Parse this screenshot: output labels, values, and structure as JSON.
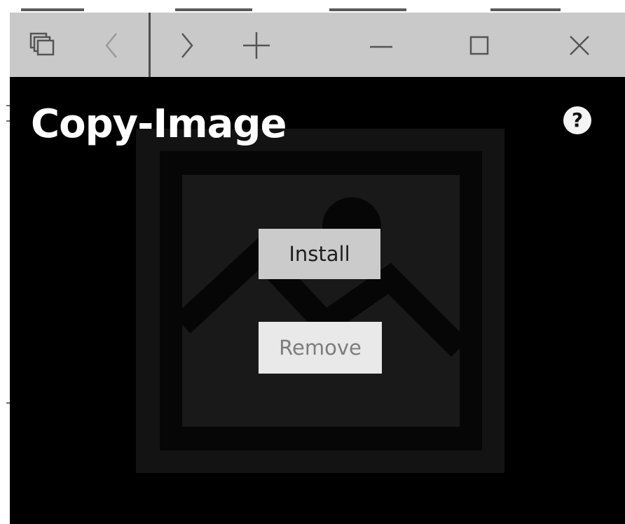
{
  "window": {
    "controls": {
      "tabs_icon": "tabs-icon",
      "back_icon": "chevron-left-icon",
      "forward_icon": "chevron-right-icon",
      "new_tab_icon": "plus-icon",
      "minimize_icon": "minimize-icon",
      "maximize_icon": "maximize-icon",
      "close_icon": "close-icon"
    }
  },
  "app": {
    "title": "Copy-Image",
    "help_label": "?",
    "help_icon": "question-circle-icon",
    "placeholder_icon": "image-placeholder-icon"
  },
  "actions": {
    "install_label": "Install",
    "remove_label": "Remove"
  },
  "colors": {
    "titlebar": "#c9c9c9",
    "background": "#000000",
    "title_text": "#ffffff",
    "install_bg": "#cbcbcb",
    "remove_bg": "#e9e9e9",
    "remove_text": "#7d7d7d"
  }
}
